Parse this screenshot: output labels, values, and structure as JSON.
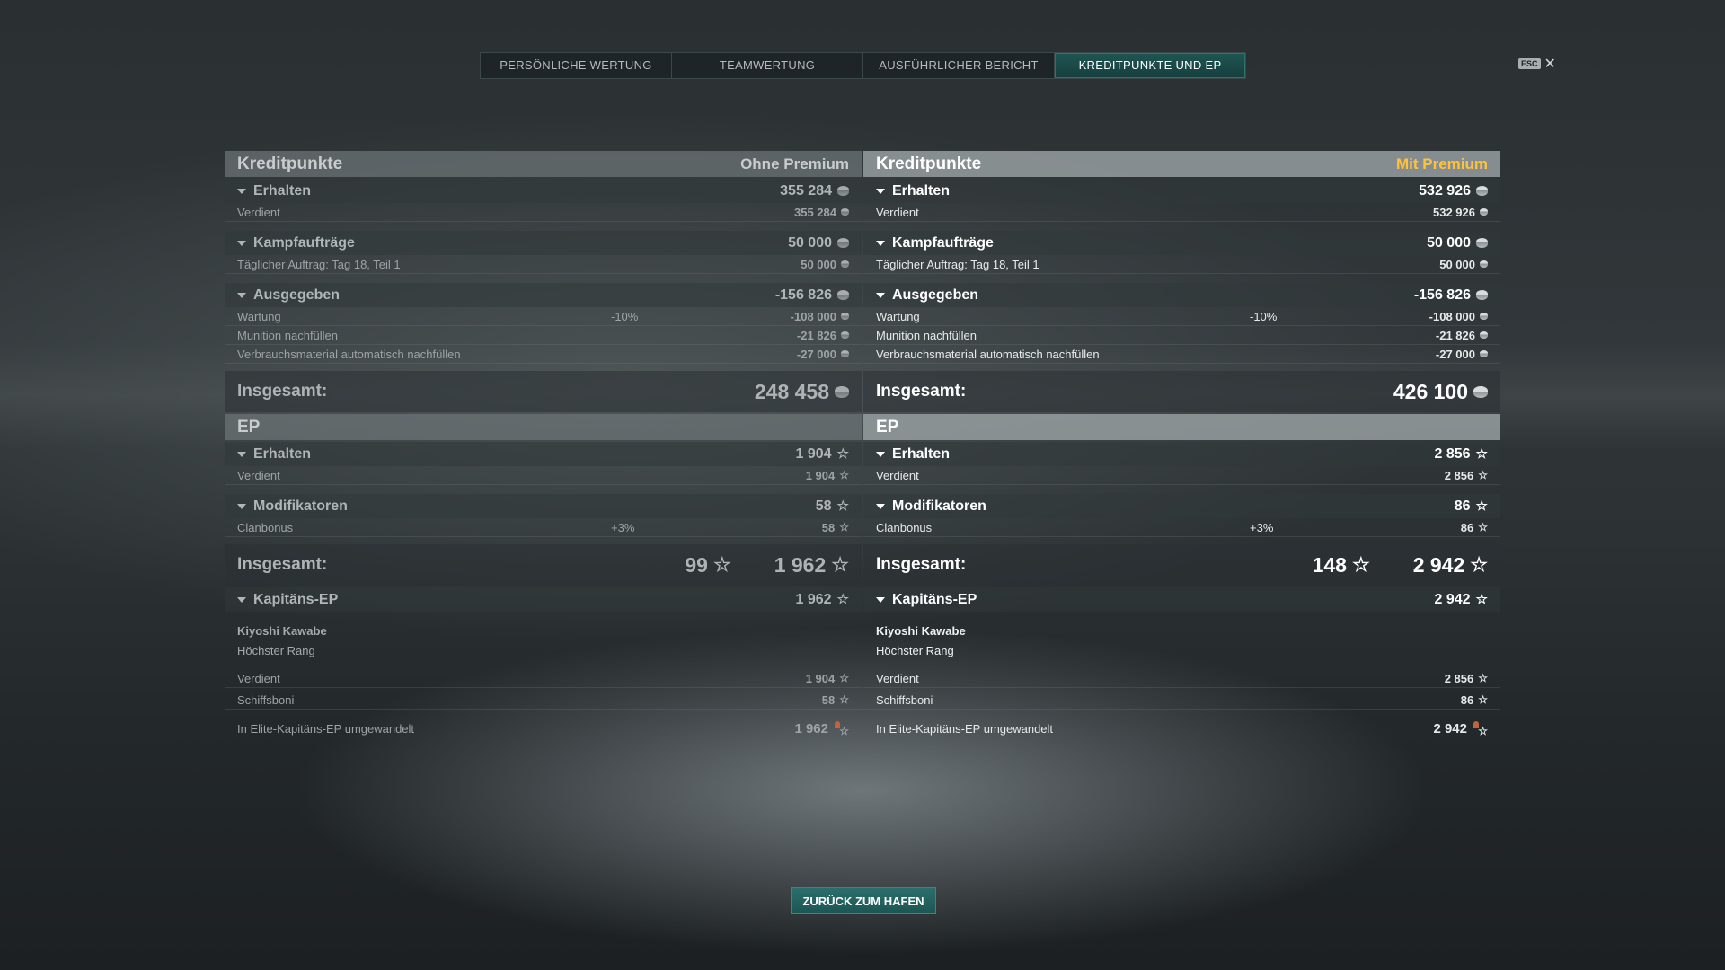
{
  "tabs": [
    {
      "label": "PERSÖNLICHE WERTUNG"
    },
    {
      "label": "TEAMWERTUNG"
    },
    {
      "label": "AUSFÜHRLICHER BERICHT"
    },
    {
      "label": "KREDITPUNKTE UND EP",
      "active": true
    }
  ],
  "esc": {
    "key": "ESC",
    "close": "✕"
  },
  "left": {
    "credits_title": "Kreditpunkte",
    "premium_label": "Ohne Premium",
    "erhalten": {
      "label": "Erhalten",
      "value": "355 284"
    },
    "verdient": {
      "label": "Verdient",
      "value": "355 284"
    },
    "kampf": {
      "label": "Kampfaufträge",
      "value": "50 000"
    },
    "taeglich": {
      "label": "Täglicher Auftrag: Tag 18, Teil 1",
      "value": "50 000"
    },
    "ausgegeben": {
      "label": "Ausgegeben",
      "value": "-156 826"
    },
    "wartung": {
      "label": "Wartung",
      "pct": "-10%",
      "value": "-108 000"
    },
    "munition": {
      "label": "Munition nachfüllen",
      "value": "-21 826"
    },
    "verbrauch": {
      "label": "Verbrauchsmaterial automatisch nachfüllen",
      "value": "-27 000"
    },
    "credits_total": {
      "label": "Insgesamt:",
      "value": "248 458"
    },
    "ep_title": "EP",
    "ep_erhalten": {
      "label": "Erhalten",
      "value": "1 904"
    },
    "ep_verdient": {
      "label": "Verdient",
      "value": "1 904"
    },
    "mods": {
      "label": "Modifikatoren",
      "value": "58"
    },
    "clan": {
      "label": "Clanbonus",
      "pct": "+3%",
      "value": "58"
    },
    "ep_total": {
      "label": "Insgesamt:",
      "bonus": "99",
      "value": "1 962"
    },
    "kap": {
      "label": "Kapitäns-EP",
      "value": "1 962"
    },
    "captain_name": "Kiyoshi Kawabe",
    "captain_rank": "Höchster Rang",
    "kap_verdient": {
      "label": "Verdient",
      "value": "1 904"
    },
    "schiff": {
      "label": "Schiffsboni",
      "value": "58"
    },
    "elite": {
      "label": "In Elite-Kapitäns-EP umgewandelt",
      "value": "1 962"
    }
  },
  "right": {
    "credits_title": "Kreditpunkte",
    "premium_label": "Mit Premium",
    "erhalten": {
      "label": "Erhalten",
      "value": "532 926"
    },
    "verdient": {
      "label": "Verdient",
      "value": "532 926"
    },
    "kampf": {
      "label": "Kampfaufträge",
      "value": "50 000"
    },
    "taeglich": {
      "label": "Täglicher Auftrag: Tag 18, Teil 1",
      "value": "50 000"
    },
    "ausgegeben": {
      "label": "Ausgegeben",
      "value": "-156 826"
    },
    "wartung": {
      "label": "Wartung",
      "pct": "-10%",
      "value": "-108 000"
    },
    "munition": {
      "label": "Munition nachfüllen",
      "value": "-21 826"
    },
    "verbrauch": {
      "label": "Verbrauchsmaterial automatisch nachfüllen",
      "value": "-27 000"
    },
    "credits_total": {
      "label": "Insgesamt:",
      "value": "426 100"
    },
    "ep_title": "EP",
    "ep_erhalten": {
      "label": "Erhalten",
      "value": "2 856"
    },
    "ep_verdient": {
      "label": "Verdient",
      "value": "2 856"
    },
    "mods": {
      "label": "Modifikatoren",
      "value": "86"
    },
    "clan": {
      "label": "Clanbonus",
      "pct": "+3%",
      "value": "86"
    },
    "ep_total": {
      "label": "Insgesamt:",
      "bonus": "148",
      "value": "2 942"
    },
    "kap": {
      "label": "Kapitäns-EP",
      "value": "2 942"
    },
    "captain_name": "Kiyoshi Kawabe",
    "captain_rank": "Höchster Rang",
    "kap_verdient": {
      "label": "Verdient",
      "value": "2 856"
    },
    "schiff": {
      "label": "Schiffsboni",
      "value": "86"
    },
    "elite": {
      "label": "In Elite-Kapitäns-EP umgewandelt",
      "value": "2 942"
    }
  },
  "back_button": "ZURÜCK ZUM HAFEN",
  "colors": {
    "accent": "#1f5553",
    "premium": "#ffc33a",
    "bonus_premium": "#c6ef8a",
    "bonus_standard": "#8fa670"
  },
  "icons": {
    "credits": "coin-icon",
    "xp": "star-icon",
    "elite_xp": "elite-captain-xp-icon",
    "section": "triangle-down-icon"
  }
}
